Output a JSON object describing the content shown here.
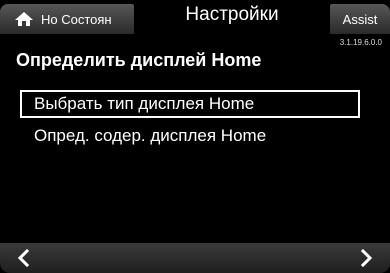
{
  "tabs": {
    "home_label": "Но Состоян",
    "active_label": "Настройки",
    "assist_label": "Assist"
  },
  "version": "3.1.19.6.0.0",
  "page_title": "Определить дисплей Home",
  "menu": {
    "items": [
      {
        "label": "Выбрать тип дисплея Home",
        "selected": true
      },
      {
        "label": "Опред. содер. дисплея Home",
        "selected": false
      }
    ]
  },
  "nav": {
    "left_icon": "chevron-left-icon",
    "right_icon": "chevron-right-icon"
  },
  "colors": {
    "background": "#000000",
    "text": "#ffffff",
    "tab_inactive": "#4a4a4a"
  }
}
